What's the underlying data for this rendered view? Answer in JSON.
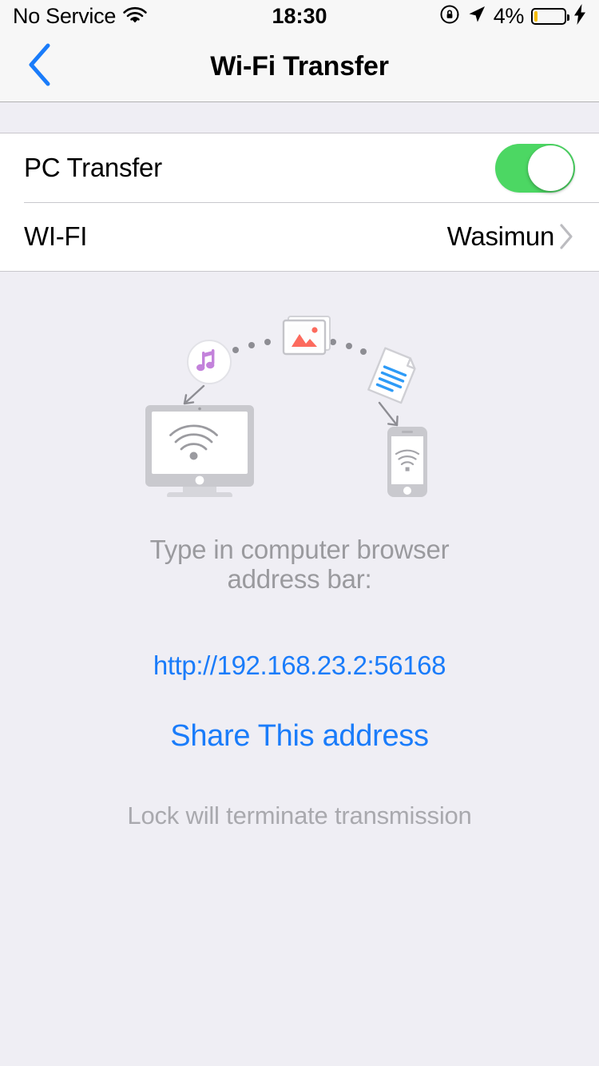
{
  "status_bar": {
    "carrier": "No Service",
    "wifi_icon": "wifi-icon",
    "time": "18:30",
    "rotation_lock_icon": "rotation-lock-icon",
    "location_icon": "location-arrow-icon",
    "battery_percent": "4%",
    "battery_level": 4,
    "charging_icon": "lightning-bolt-icon",
    "battery_color": "#f5bc00"
  },
  "nav": {
    "back_icon": "back-chevron-icon",
    "title": "Wi-Fi Transfer",
    "tint_color": "#1a7cfa"
  },
  "settings": {
    "pc_transfer": {
      "label": "PC Transfer",
      "toggle_on": true,
      "toggle_color": "#4cd763"
    },
    "wifi": {
      "label": "WI-FI",
      "value": "Wasimun",
      "chevron_icon": "disclosure-chevron-icon"
    }
  },
  "illustration": {
    "monitor_icon": "desktop-monitor-wifi-icon",
    "phone_icon": "smartphone-wifi-icon",
    "music_icon": "music-note-icon",
    "photo_icon": "photo-stack-icon",
    "document_icon": "document-icon",
    "music_color": "#c382db",
    "photo_color": "#fc6a5d",
    "document_color": "#2e9bf7",
    "device_color": "#c9c9ce"
  },
  "main": {
    "hint_line1": "Type in computer browser",
    "hint_line2": "address bar:",
    "url": "http://192.168.23.2:56168",
    "share_label": "Share This address",
    "lock_note": "Lock will terminate transmission",
    "link_color": "#1a7cfa",
    "hint_color": "#9a9a9e"
  }
}
